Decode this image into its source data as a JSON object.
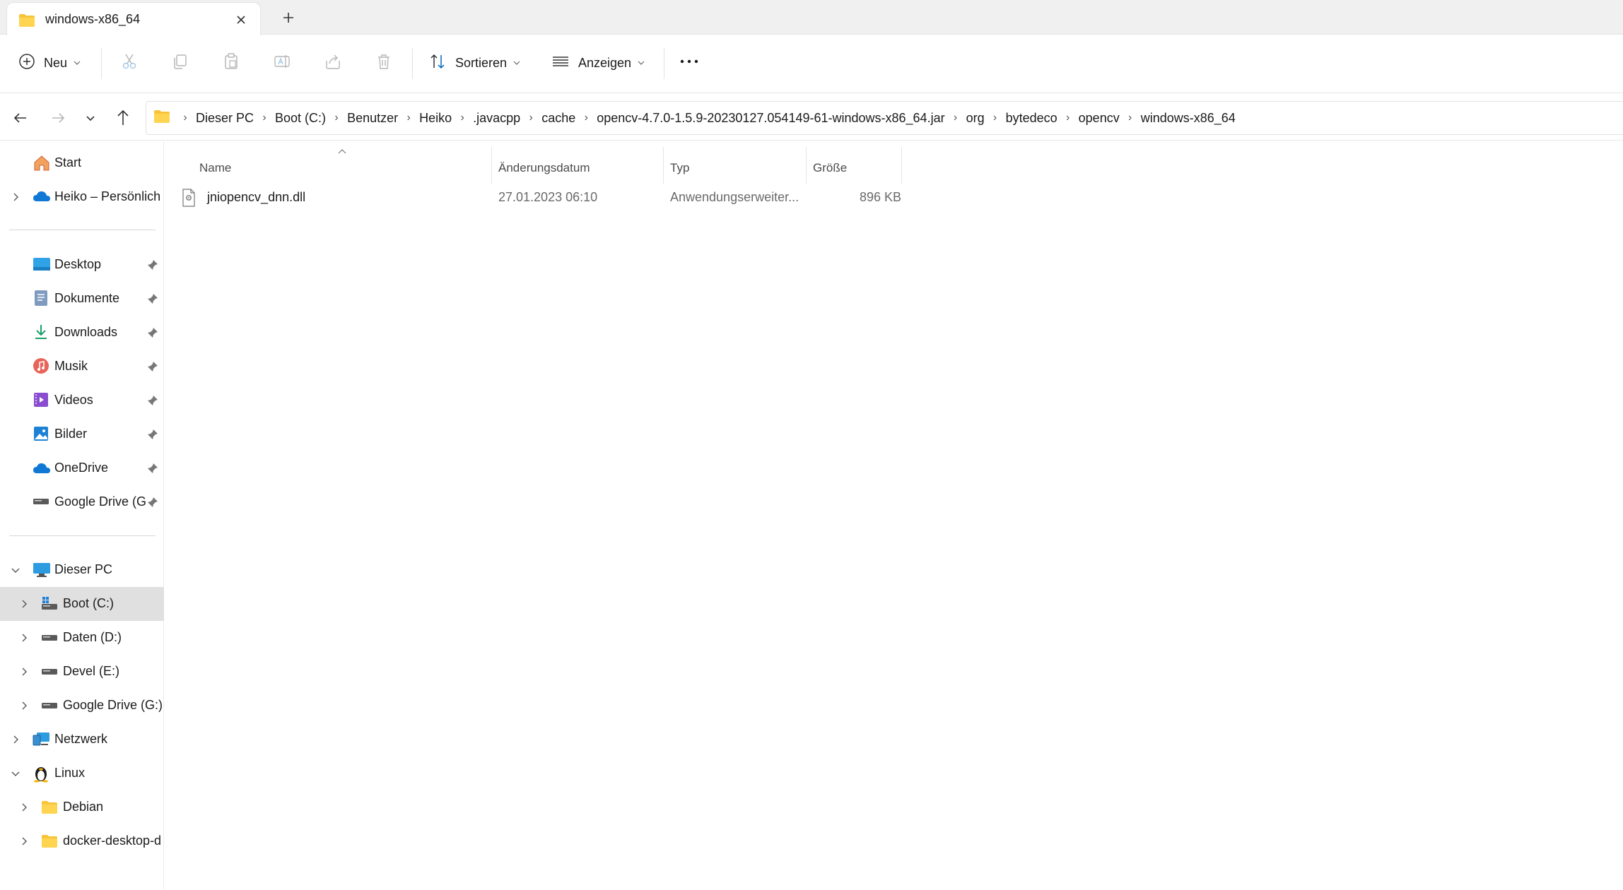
{
  "tab": {
    "title": "windows-x86_64",
    "close_icon": "close-icon",
    "new_tab_icon": "plus-icon"
  },
  "toolbar": {
    "new_label": "Neu",
    "sort_label": "Sortieren",
    "view_label": "Anzeigen",
    "icons": [
      "add-circle-icon",
      "cut-icon",
      "copy-icon",
      "paste-icon",
      "rename-icon",
      "share-icon",
      "delete-icon",
      "sort-icon",
      "view-icon",
      "more-icon"
    ]
  },
  "address": {
    "crumbs": [
      "Dieser PC",
      "Boot (C:)",
      "Benutzer",
      "Heiko",
      ".javacpp",
      "cache",
      "opencv-4.7.0-1.5.9-20230127.054149-61-windows-x86_64.jar",
      "org",
      "bytedeco",
      "opencv",
      "windows-x86_64"
    ]
  },
  "sidebar": {
    "top": [
      {
        "label": "Start",
        "icon": "home-icon"
      },
      {
        "label": "Heiko – Persönlich",
        "icon": "onedrive-cloud-icon"
      }
    ],
    "pinned": [
      {
        "label": "Desktop",
        "icon": "desktop-icon"
      },
      {
        "label": "Dokumente",
        "icon": "documents-icon"
      },
      {
        "label": "Downloads",
        "icon": "downloads-icon"
      },
      {
        "label": "Musik",
        "icon": "music-icon"
      },
      {
        "label": "Videos",
        "icon": "videos-icon"
      },
      {
        "label": "Bilder",
        "icon": "pictures-icon"
      },
      {
        "label": "OneDrive",
        "icon": "onedrive-cloud-icon"
      },
      {
        "label": "Google Drive (G:",
        "icon": "drive-icon"
      }
    ],
    "tree": [
      {
        "label": "Dieser PC",
        "icon": "computer-icon"
      },
      {
        "label": "Boot (C:)",
        "icon": "windows-drive-icon"
      },
      {
        "label": "Daten (D:)",
        "icon": "drive-icon"
      },
      {
        "label": "Devel (E:)",
        "icon": "drive-icon"
      },
      {
        "label": "Google Drive (G:)",
        "icon": "drive-icon"
      },
      {
        "label": "Netzwerk",
        "icon": "network-icon"
      },
      {
        "label": "Linux",
        "icon": "linux-penguin-icon"
      },
      {
        "label": "Debian",
        "icon": "folder-icon"
      },
      {
        "label": "docker-desktop-d",
        "icon": "folder-icon"
      }
    ]
  },
  "columns": {
    "name": "Name",
    "date": "Änderungsdatum",
    "type": "Typ",
    "size": "Größe"
  },
  "files": [
    {
      "name": "jniopencv_dnn.dll",
      "date": "27.01.2023 06:10",
      "type": "Anwendungserweiter...",
      "size": "896 KB",
      "icon": "dll-file-icon"
    }
  ],
  "colors": {
    "selected_bg": "#e0e0e0",
    "accent": "#0067c0",
    "folder": "#f8c43a"
  }
}
